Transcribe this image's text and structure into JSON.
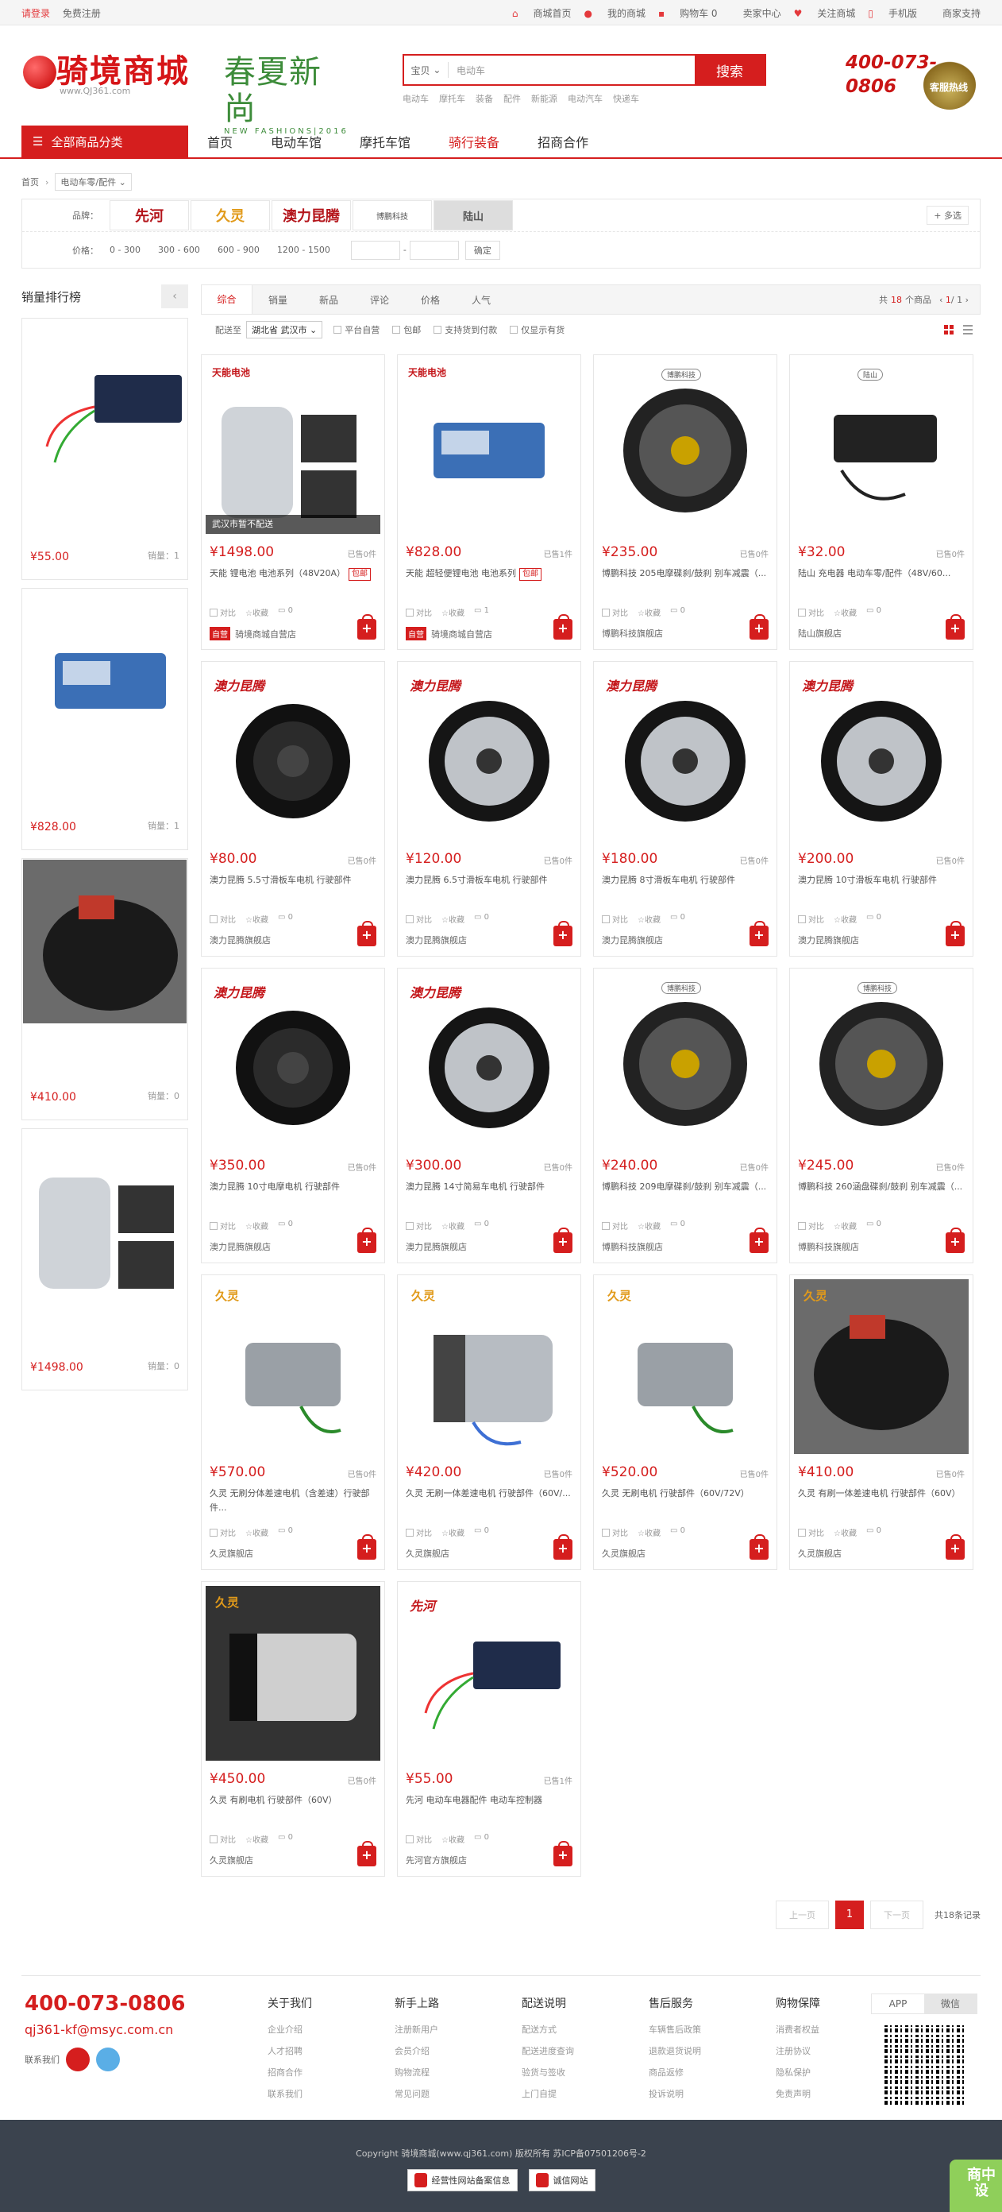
{
  "topbar": {
    "login": "请登录",
    "register": "免费注册",
    "links": [
      "商城首页",
      "我的商城",
      "购物车 0",
      "卖家中心",
      "关注商城",
      "手机版",
      "商家支持"
    ]
  },
  "header": {
    "logo_text": "骑境商城",
    "logo_url": "www.QJ361.com",
    "spring_title": "春夏新尚",
    "spring_sub": "NEW FASHIONS|2016",
    "search_cat": "宝贝",
    "search_placeholder": "电动车",
    "search_button": "搜索",
    "hot_words": [
      "电动车",
      "摩托车",
      "装备",
      "配件",
      "新能源",
      "电动汽车",
      "快递车"
    ],
    "tel_line1": "400-073-",
    "tel_line2": "0806",
    "hotline_badge": "客服热线"
  },
  "nav": {
    "all_categories": "全部商品分类",
    "items": [
      "首页",
      "电动车馆",
      "摩托车馆",
      "骑行装备",
      "招商合作"
    ]
  },
  "breadcrumb": {
    "home": "首页",
    "current": "电动车零/配件"
  },
  "filter": {
    "brand_label": "品牌：",
    "brands": [
      "先河",
      "久灵",
      "澳力昆腾",
      "博鹏科技",
      "陆山"
    ],
    "more": "+ 多选",
    "price_label": "价格：",
    "price_ranges": [
      "0 - 300",
      "300 - 600",
      "600 - 900",
      "1200 - 1500"
    ],
    "confirm": "确定"
  },
  "ranking": {
    "title": "销量排行榜",
    "items": [
      {
        "price": "¥55.00",
        "sales": "销量：1"
      },
      {
        "price": "¥828.00",
        "sales": "销量：1"
      },
      {
        "price": "¥410.00",
        "sales": "销量：0"
      },
      {
        "price": "¥1498.00",
        "sales": "销量：0"
      }
    ]
  },
  "sortbar": {
    "sorts": [
      "综合",
      "销量",
      "新品",
      "评论",
      "价格",
      "人气"
    ],
    "count_prefix": "共",
    "count": "18",
    "count_suffix": "个商品",
    "page": "1",
    "pages": "/ 1"
  },
  "options": {
    "ship_to": "配送至",
    "region": "湖北省 武汉市",
    "checks": [
      "平台自营",
      "包邮",
      "支持货到付款",
      "仅显示有货"
    ]
  },
  "card_labels": {
    "compare": "对比",
    "collect": "收藏",
    "self": "自营",
    "free_ship": "包邮"
  },
  "products": [
    {
      "price": "¥1498.00",
      "sold": "已售0件",
      "name": "天能 锂电池 电池系列（48V20A）",
      "tag": "包邮",
      "comments": "0",
      "shop": "骑境商城自营店",
      "self": true,
      "overlay": "武汉市暂不配送",
      "brand": "天能电池"
    },
    {
      "price": "¥828.00",
      "sold": "已售1件",
      "name": "天能 超轻便锂电池 电池系列",
      "tag": "包邮",
      "comments": "1",
      "shop": "骑境商城自营店",
      "self": true,
      "brand": "天能电池"
    },
    {
      "price": "¥235.00",
      "sold": "已售0件",
      "name": "博鹏科技 205电摩碟刹/鼓刹 别车减震（...",
      "comments": "0",
      "shop": "博鹏科技旗舰店",
      "brand": "博鹏科技"
    },
    {
      "price": "¥32.00",
      "sold": "已售0件",
      "name": "陆山 充电器 电动车零/配件（48V/60...",
      "comments": "0",
      "shop": "陆山旗舰店",
      "brand": "陆山"
    },
    {
      "price": "¥80.00",
      "sold": "已售0件",
      "name": "澳力昆腾 5.5寸滑板车电机 行驶部件",
      "comments": "0",
      "shop": "澳力昆腾旗舰店",
      "brand": "澳力昆腾"
    },
    {
      "price": "¥120.00",
      "sold": "已售0件",
      "name": "澳力昆腾 6.5寸滑板车电机 行驶部件",
      "comments": "0",
      "shop": "澳力昆腾旗舰店",
      "brand": "澳力昆腾"
    },
    {
      "price": "¥180.00",
      "sold": "已售0件",
      "name": "澳力昆腾 8寸滑板车电机 行驶部件",
      "comments": "0",
      "shop": "澳力昆腾旗舰店",
      "brand": "澳力昆腾"
    },
    {
      "price": "¥200.00",
      "sold": "已售0件",
      "name": "澳力昆腾 10寸滑板车电机 行驶部件",
      "comments": "0",
      "shop": "澳力昆腾旗舰店",
      "brand": "澳力昆腾"
    },
    {
      "price": "¥350.00",
      "sold": "已售0件",
      "name": "澳力昆腾 10寸电摩电机 行驶部件",
      "comments": "0",
      "shop": "澳力昆腾旗舰店",
      "brand": "澳力昆腾"
    },
    {
      "price": "¥300.00",
      "sold": "已售0件",
      "name": "澳力昆腾 14寸简易车电机 行驶部件",
      "comments": "0",
      "shop": "澳力昆腾旗舰店",
      "brand": "澳力昆腾"
    },
    {
      "price": "¥240.00",
      "sold": "已售0件",
      "name": "博鹏科技 209电摩碟刹/鼓刹 别车减震（...",
      "comments": "0",
      "shop": "博鹏科技旗舰店",
      "brand": "博鹏科技"
    },
    {
      "price": "¥245.00",
      "sold": "已售0件",
      "name": "博鹏科技 260涵盘碟刹/鼓刹 别车减震（...",
      "comments": "0",
      "shop": "博鹏科技旗舰店",
      "brand": "博鹏科技"
    },
    {
      "price": "¥570.00",
      "sold": "已售0件",
      "name": "久灵 无刷分体差速电机（含差速）行驶部件...",
      "comments": "0",
      "shop": "久灵旗舰店",
      "brand": "久灵"
    },
    {
      "price": "¥420.00",
      "sold": "已售0件",
      "name": "久灵 无刷一体差速电机 行驶部件（60V/...",
      "comments": "0",
      "shop": "久灵旗舰店",
      "brand": "久灵"
    },
    {
      "price": "¥520.00",
      "sold": "已售0件",
      "name": "久灵 无刷电机 行驶部件（60V/72V）",
      "comments": "0",
      "shop": "久灵旗舰店",
      "brand": "久灵"
    },
    {
      "price": "¥410.00",
      "sold": "已售0件",
      "name": "久灵 有刷一体差速电机 行驶部件（60V）",
      "comments": "0",
      "shop": "久灵旗舰店",
      "brand": "久灵"
    },
    {
      "price": "¥450.00",
      "sold": "已售0件",
      "name": "久灵 有刷电机 行驶部件（60V）",
      "comments": "0",
      "shop": "久灵旗舰店",
      "brand": "久灵"
    },
    {
      "price": "¥55.00",
      "sold": "已售1件",
      "name": "先河 电动车电器配件 电动车控制器",
      "comments": "0",
      "shop": "先河官方旗舰店",
      "brand": "先河"
    }
  ],
  "pager": {
    "prev": "上一页",
    "current": "1",
    "next": "下一页",
    "total": "共18条记录"
  },
  "footer": {
    "tel": "400-073-0806",
    "email": "qj361-kf@msyc.com.cn",
    "contact": "联系我们",
    "columns": [
      {
        "title": "关于我们",
        "links": [
          "企业介绍",
          "人才招聘",
          "招商合作",
          "联系我们"
        ]
      },
      {
        "title": "新手上路",
        "links": [
          "注册新用户",
          "会员介绍",
          "购物流程",
          "常见问题"
        ]
      },
      {
        "title": "配送说明",
        "links": [
          "配送方式",
          "配送进度查询",
          "验货与签收",
          "上门自提"
        ]
      },
      {
        "title": "售后服务",
        "links": [
          "车辆售后政策",
          "退款退货说明",
          "商品返修",
          "投诉说明"
        ]
      },
      {
        "title": "购物保障",
        "links": [
          "消费者权益",
          "注册协议",
          "隐私保护",
          "免责声明"
        ]
      }
    ],
    "qr_tabs": [
      "APP",
      "微信"
    ],
    "copyright": "Copyright 骑境商城(www.qj361.com) 版权所有 苏ICP备07501206号-2",
    "badges": [
      "经营性网站备案信息",
      "诚信网站"
    ],
    "corner": "商中设"
  }
}
